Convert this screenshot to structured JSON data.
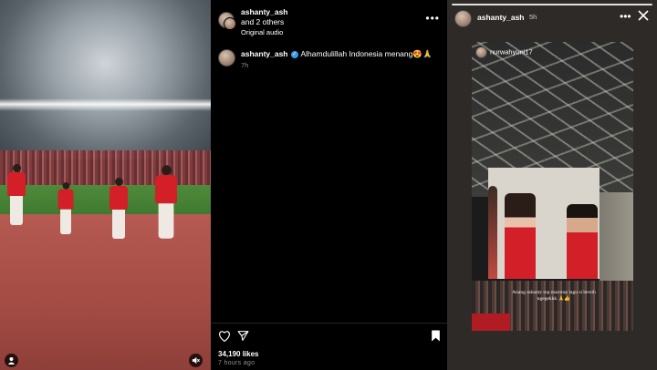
{
  "left_video": {
    "icons": {
      "profile": "person-icon",
      "sound": "speaker-muted-icon"
    }
  },
  "post": {
    "header": {
      "username": "ashanty_ash",
      "others": "and 2 others",
      "audio": "Original audio"
    },
    "caption": {
      "username": "ashanty_ash",
      "text": "Alhamdulillah Indonesia menang😍🙏",
      "time": "7h"
    },
    "likes": "34,190 likes",
    "posted_ago": "7 hours ago"
  },
  "story": {
    "username": "ashanty_ash",
    "time": "5h",
    "shared_from": "nurwahyuni17",
    "caption": "Anang ashanty top marotop lagu si bersih ngegekkk 🙏👍"
  },
  "colors": {
    "jersey_red": "#d21f28",
    "verified_blue": "#3897f0"
  }
}
